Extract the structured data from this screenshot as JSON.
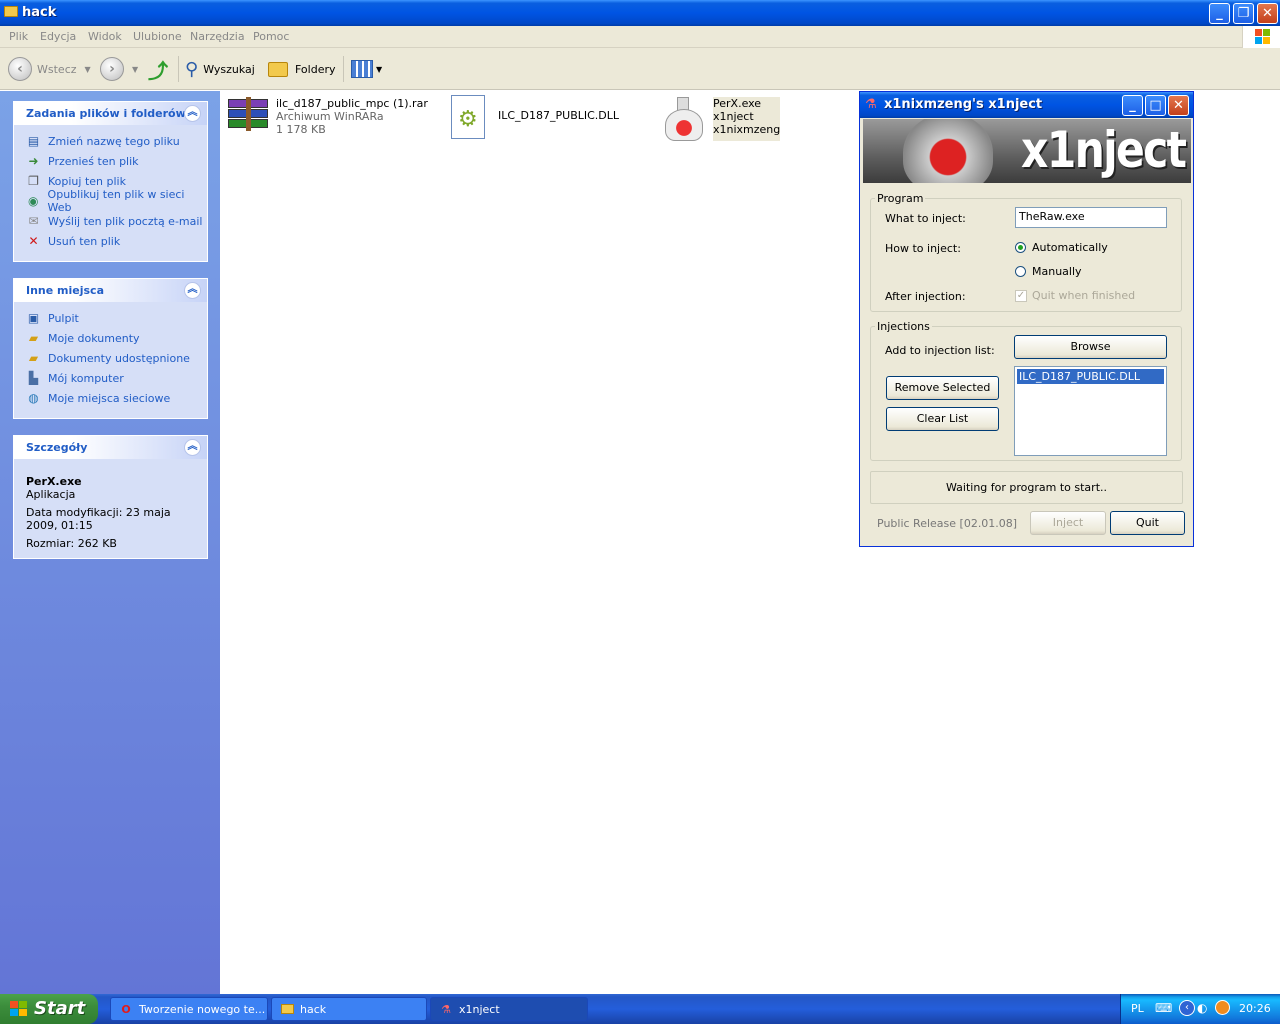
{
  "window": {
    "title": "hack"
  },
  "menu": [
    "Plik",
    "Edycja",
    "Widok",
    "Ulubione",
    "Narzędzia",
    "Pomoc"
  ],
  "toolbar": {
    "back_label": "Wstecz",
    "search_label": "Wyszukaj",
    "folders_label": "Foldery"
  },
  "tasks": {
    "header": "Zadania plików i folderów",
    "items": [
      {
        "label": "Zmień nazwę tego pliku",
        "icon": "rename-icon"
      },
      {
        "label": "Przenieś ten plik",
        "icon": "move-icon"
      },
      {
        "label": "Kopiuj ten plik",
        "icon": "copy-icon"
      },
      {
        "label": "Opublikuj ten plik w sieci Web",
        "icon": "web-publish-icon"
      },
      {
        "label": "Wyślij ten plik pocztą e-mail",
        "icon": "email-icon"
      },
      {
        "label": "Usuń ten plik",
        "icon": "delete-icon"
      }
    ]
  },
  "places": {
    "header": "Inne miejsca",
    "items": [
      {
        "label": "Pulpit",
        "icon": "desktop-icon"
      },
      {
        "label": "Moje dokumenty",
        "icon": "documents-icon"
      },
      {
        "label": "Dokumenty udostępnione",
        "icon": "shared-folder-icon"
      },
      {
        "label": "Mój komputer",
        "icon": "computer-icon"
      },
      {
        "label": "Moje miejsca sieciowe",
        "icon": "network-icon"
      }
    ]
  },
  "details": {
    "header": "Szczegóły",
    "name": "PerX.exe",
    "type": "Aplikacja",
    "modified": "Data modyfikacji: 23 maja 2009, 01:15",
    "size": "Rozmiar: 262 KB"
  },
  "files": [
    {
      "name": "ilc_d187_public_mpc (1).rar",
      "line2": "Archiwum WinRARa",
      "line3": "1 178 KB",
      "icon": "winrar-archive-icon"
    },
    {
      "name": "ILC_D187_PUBLIC.DLL",
      "line2": "",
      "line3": "",
      "icon": "dll-file-icon"
    },
    {
      "name": "PerX.exe",
      "line2": "x1nject",
      "line3": "x1nixmzeng",
      "icon": "flask-app-icon"
    }
  ],
  "dialog": {
    "title": "x1nixmzeng's x1nject",
    "banner": "x1nject",
    "program_group": "Program",
    "what_label": "What to inject:",
    "what_value": "TheRaw.exe",
    "how_label": "How to inject:",
    "auto_label": "Automatically",
    "manual_label": "Manually",
    "after_label": "After injection:",
    "quit_label": "Quit when finished",
    "injections_group": "Injections",
    "add_label": "Add to injection list:",
    "browse": "Browse",
    "remove": "Remove Selected",
    "clear": "Clear List",
    "list_items": [
      "ILC_D187_PUBLIC.DLL"
    ],
    "status": "Waiting for program to start..",
    "release": "Public Release [02.01.08]",
    "inject": "Inject",
    "quit": "Quit"
  },
  "taskbar": {
    "start": "Start",
    "tasks": [
      {
        "label": "Tworzenie nowego te...",
        "icon": "opera-icon"
      },
      {
        "label": "hack",
        "icon": "folder-icon"
      },
      {
        "label": "x1nject",
        "icon": "flask-icon"
      }
    ],
    "lang": "PL",
    "clock": "20:26"
  }
}
